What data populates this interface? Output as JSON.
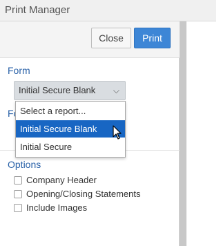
{
  "window": {
    "title": "Print Manager"
  },
  "toolbar": {
    "close_label": "Close",
    "print_label": "Print"
  },
  "form": {
    "label": "Form",
    "select_value": "Initial Secure Blank",
    "options": [
      "Select a report...",
      "Initial Secure Blank",
      "Initial Secure"
    ],
    "selected_index": 1,
    "second_label_partial": "Fo"
  },
  "options_section": {
    "label": "Options",
    "items": [
      {
        "label": "Company Header",
        "checked": false
      },
      {
        "label": "Opening/Closing Statements",
        "checked": false
      },
      {
        "label": "Include Images",
        "checked": false
      }
    ]
  },
  "colors": {
    "accent": "#3d86d6",
    "highlight": "#1866c3",
    "label": "#2a62a8"
  }
}
